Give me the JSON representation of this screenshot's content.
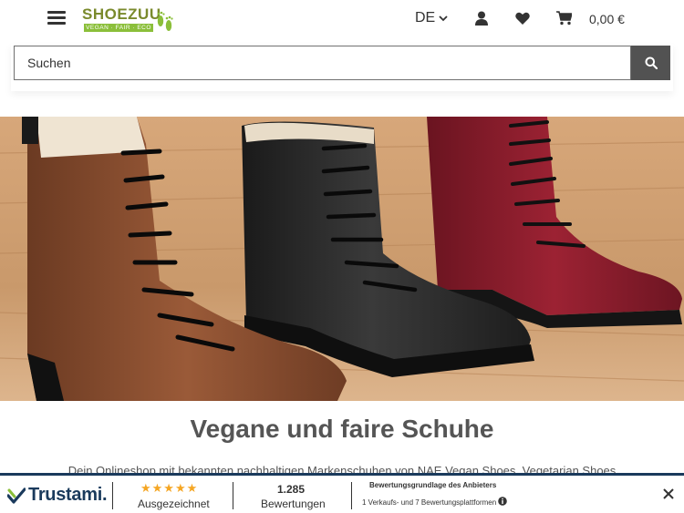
{
  "header": {
    "logo_name": "SHOEZUU",
    "logo_tagline": "VEGAN · FAIR · ECO",
    "language": "DE",
    "cart_total": "0,00 €",
    "icons": [
      "menu-icon",
      "user-icon",
      "heart-icon",
      "cart-icon"
    ]
  },
  "search": {
    "placeholder": "Suchen",
    "button_icon": "search-icon"
  },
  "hero": {
    "title": "Vegane und faire Schuhe",
    "description": "Dein Onlineshop mit bekannten nachhaltigen Markenschuhen von NAE Vegan Shoes, Vegetarian Shoes"
  },
  "trustami": {
    "brand": "Trustami.",
    "rating_label": "Ausgezeichnet",
    "review_count": "1.285",
    "reviews_label": "Bewertungen",
    "basis_title": "Bewertungsgrundlage des Anbieters",
    "basis_detail": "1 Verkaufs- und 7 Bewertungsplattformen",
    "star_count": 5,
    "colors": {
      "navy": "#1a3a5c",
      "green": "#8bbf3a",
      "star": "#f5a623"
    }
  }
}
